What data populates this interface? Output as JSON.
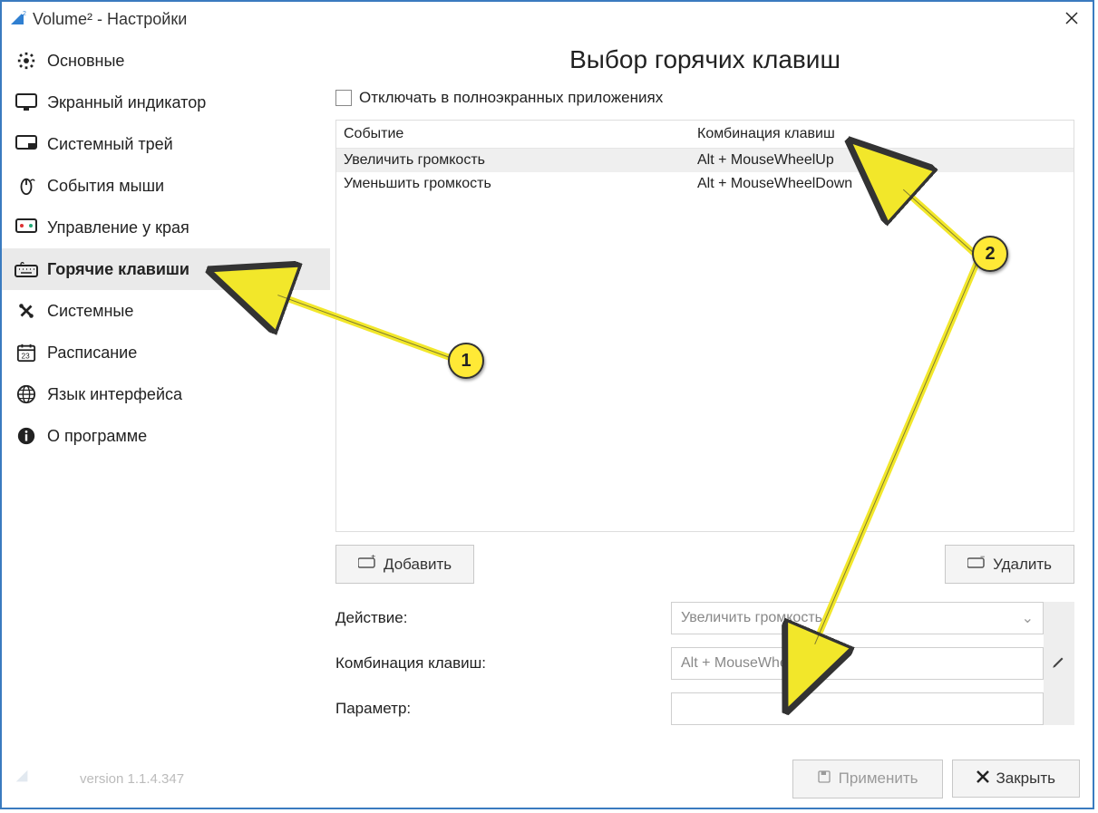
{
  "window": {
    "title": "Volume² - Настройки"
  },
  "sidebar": {
    "items": [
      {
        "label": "Основные"
      },
      {
        "label": "Экранный индикатор"
      },
      {
        "label": "Системный трей"
      },
      {
        "label": "События мыши"
      },
      {
        "label": "Управление у края"
      },
      {
        "label": "Горячие клавиши"
      },
      {
        "label": "Системные"
      },
      {
        "label": "Расписание"
      },
      {
        "label": "Язык интерфейса"
      },
      {
        "label": "О программе"
      }
    ]
  },
  "page": {
    "title": "Выбор горячих клавиш",
    "disable_fullscreen_label": "Отключать в полноэкранных приложениях"
  },
  "table": {
    "headers": {
      "event": "Событие",
      "combo": "Комбинация клавиш"
    },
    "rows": [
      {
        "event": "Увеличить громкость",
        "combo": "Alt + MouseWheelUp"
      },
      {
        "event": "Уменьшить громкость",
        "combo": "Alt + MouseWheelDown"
      }
    ]
  },
  "buttons": {
    "add": "Добавить",
    "delete": "Удалить",
    "apply": "Применить",
    "close": "Закрыть"
  },
  "form": {
    "action_label": "Действие:",
    "action_value": "Увеличить громкость",
    "combo_label": "Комбинация клавиш:",
    "combo_value": "Alt + MouseWheelUp",
    "param_label": "Параметр:",
    "param_value": ""
  },
  "footer": {
    "version": "version 1.1.4.347"
  },
  "annotations": {
    "one": "1",
    "two": "2"
  }
}
